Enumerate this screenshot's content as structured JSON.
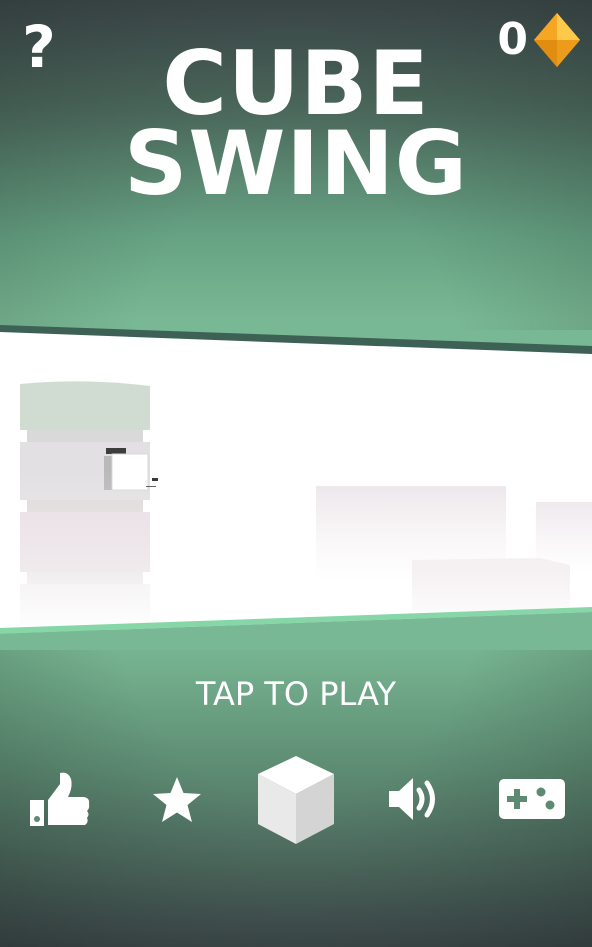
{
  "game": {
    "title_line1": "CUBE",
    "title_line2": "SWING",
    "gems": "0",
    "prompt": "TAP TO PLAY"
  },
  "top_bar": {
    "help_label": "?",
    "gem_icon": "orange-diamond-gem"
  },
  "bottom_menu": {
    "icons": [
      "thumbs-up-icon",
      "star-icon",
      "cube-icon",
      "speaker-icon",
      "gamepad-icon"
    ]
  },
  "colors": {
    "accent_green": "#79b894",
    "dark_edge": "#3f4b4c",
    "gem_orange": "#f5a623",
    "text": "#ffffff"
  }
}
